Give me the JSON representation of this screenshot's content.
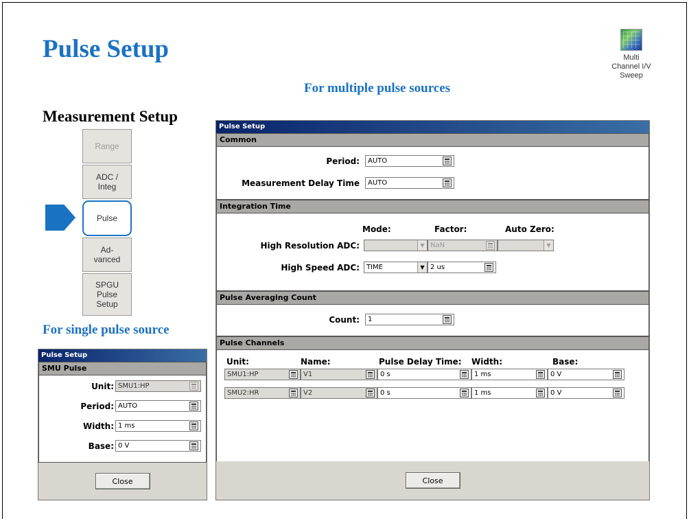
{
  "slide": {
    "title": "Pulse Setup",
    "subtitle": "Measurement Setup",
    "caption_multi": "For multiple pulse sources",
    "caption_single": "For single pulse source"
  },
  "app_icon": {
    "icon": "multi-channel-iv-sweep-icon",
    "label": "Multi\nChannel I/V\nSweep"
  },
  "nav": {
    "items": [
      {
        "label": "Range",
        "state": "disabled"
      },
      {
        "label": "ADC /\nInteg",
        "state": "normal"
      },
      {
        "label": "Pulse",
        "state": "active"
      },
      {
        "label": "Ad-\nvanced",
        "state": "normal"
      },
      {
        "label": "SPGU\nPulse\nSetup",
        "state": "normal"
      }
    ]
  },
  "multi_dialog": {
    "title": "Pulse Setup",
    "common": {
      "header": "Common",
      "period_label": "Period:",
      "period_value": "AUTO",
      "delay_label": "Measurement  Delay Time",
      "delay_value": "AUTO"
    },
    "integration": {
      "header": "Integration Time",
      "col_mode": "Mode:",
      "col_factor": "Factor:",
      "col_autozero": "Auto Zero:",
      "hr_label": "High Resolution ADC:",
      "hr_mode": "",
      "hr_factor": "NaN",
      "hr_autozero": "",
      "hs_label": "High Speed ADC:",
      "hs_mode": "TIME",
      "hs_factor": "2 us"
    },
    "averaging": {
      "header": "Pulse Averaging Count",
      "count_label": "Count:",
      "count_value": "1"
    },
    "channels": {
      "header": "Pulse Channels",
      "columns": [
        "Unit:",
        "Name:",
        "Pulse Delay Time:",
        "Width:",
        "Base:"
      ],
      "rows": [
        {
          "unit": "SMU1:HP",
          "name": "V1",
          "delay": "0 s",
          "width": "1 ms",
          "base": "0 V"
        },
        {
          "unit": "SMU2:HR",
          "name": "V2",
          "delay": "0 s",
          "width": "1 ms",
          "base": "0 V"
        }
      ]
    },
    "close_label": "Close"
  },
  "single_dialog": {
    "title": "Pulse Setup",
    "header": "SMU Pulse",
    "unit_label": "Unit:",
    "unit_value": "SMU1:HP",
    "period_label": "Period:",
    "period_value": "AUTO",
    "width_label": "Width:",
    "width_value": "1 ms",
    "base_label": "Base:",
    "base_value": "0 V",
    "close_label": "Close"
  }
}
